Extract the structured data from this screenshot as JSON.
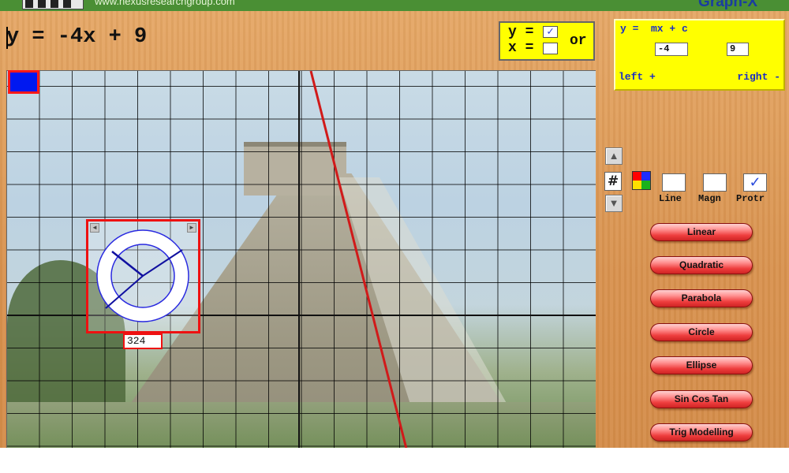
{
  "header": {
    "site_url": "www.nexusresearchgroup.com",
    "brand": "Graph-X"
  },
  "equation": {
    "text": "y = -4x + 9",
    "line_color": "#d11a1a"
  },
  "equation_form": {
    "y_label": "y =",
    "x_label": "x =",
    "or_label": "or",
    "y_checked": true,
    "x_checked": false,
    "y_check_glyph": "✓",
    "x_check_glyph": ""
  },
  "line_params": {
    "title": "y =  mx + c",
    "m_value": "-4",
    "c_value": "9",
    "left_label": "left +",
    "right_label": "right -"
  },
  "graph": {
    "swatch_color": "#0018f0",
    "background": "photo of stepped stone pyramid",
    "grid": true
  },
  "protractor": {
    "angle_value": "324",
    "left_arrow": "◄",
    "right_arrow": "►"
  },
  "tools": {
    "up_arrow": "▲",
    "down_arrow": "▼",
    "grid_glyph": "#",
    "line_label": "Line",
    "magn_label": "Magn",
    "protr_label": "Protr",
    "line_checked": false,
    "magn_checked": false,
    "protr_checked": true,
    "check_glyph": "✓"
  },
  "menu": [
    {
      "label": "Linear"
    },
    {
      "label": "Quadratic"
    },
    {
      "label": "Parabola"
    },
    {
      "label": "Circle"
    },
    {
      "label": "Ellipse"
    },
    {
      "label": "Sin Cos Tan"
    },
    {
      "label": "Trig Modelling"
    }
  ]
}
